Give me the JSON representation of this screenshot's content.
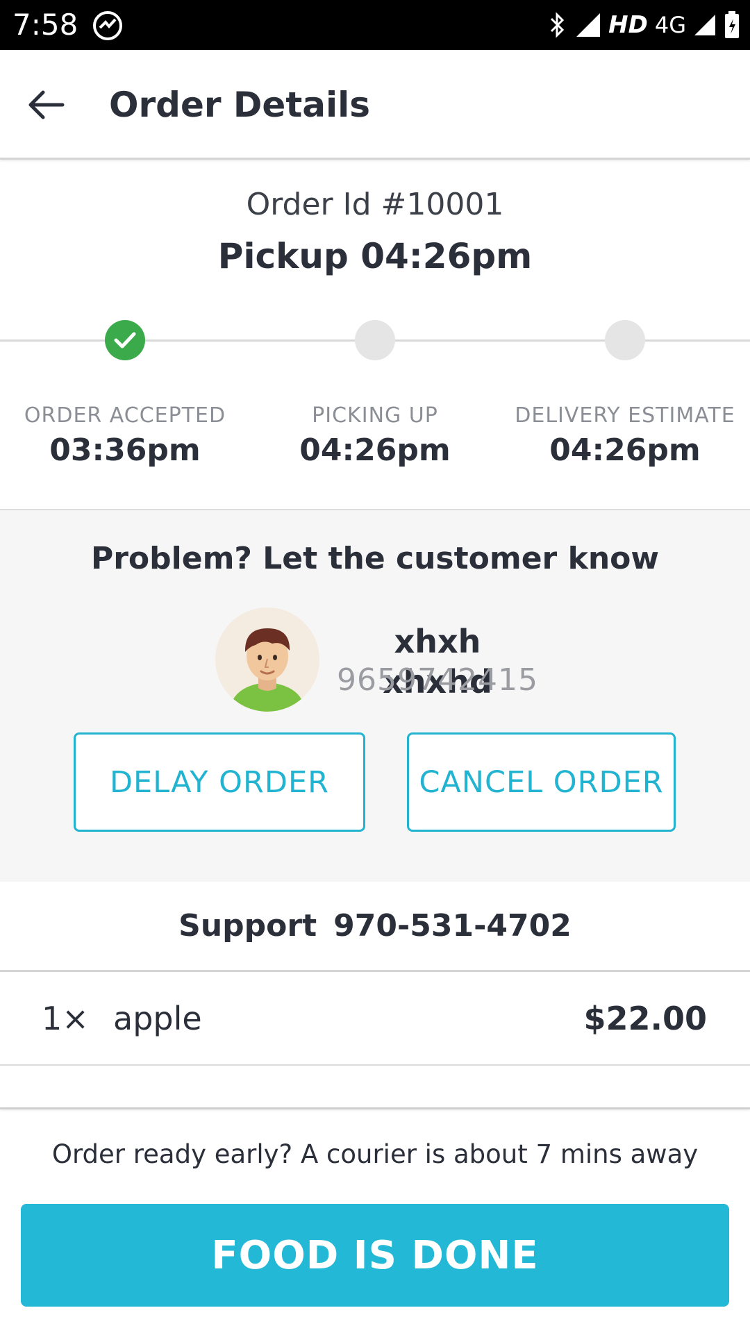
{
  "status_bar": {
    "time": "7:58",
    "network": "HD",
    "network_type": "4G",
    "icons": [
      "sync-icon",
      "bluetooth-icon",
      "signal-icon",
      "signal-icon",
      "battery-icon"
    ]
  },
  "header": {
    "back_icon": "arrow-left-icon",
    "title": "Order Details"
  },
  "order": {
    "id_label": "Order Id #10001",
    "pickup_label": "Pickup 04:26pm"
  },
  "timeline": {
    "steps": [
      {
        "label": "ORDER ACCEPTED",
        "time": "03:36pm",
        "completed": true
      },
      {
        "label": "PICKING UP",
        "time": "04:26pm",
        "completed": false
      },
      {
        "label": "DELIVERY ESTIMATE",
        "time": "04:26pm",
        "completed": false
      }
    ]
  },
  "problem": {
    "title": "Problem? Let the customer know",
    "customer_name": "xhxh xhxhd",
    "customer_phone": "9659742415",
    "delay_label": "DELAY ORDER",
    "cancel_label": "CANCEL ORDER"
  },
  "support": {
    "label": "Support",
    "phone": "970-531-4702"
  },
  "items": [
    {
      "qty": "1×",
      "name": "apple",
      "price": "$22.00"
    }
  ],
  "footer": {
    "note": "Order ready early? A courier is about 7 mins away",
    "done_label": "FOOD IS DONE"
  },
  "colors": {
    "accent": "#22b8d6",
    "success": "#3aaa4a",
    "text": "#2b2f3a"
  }
}
